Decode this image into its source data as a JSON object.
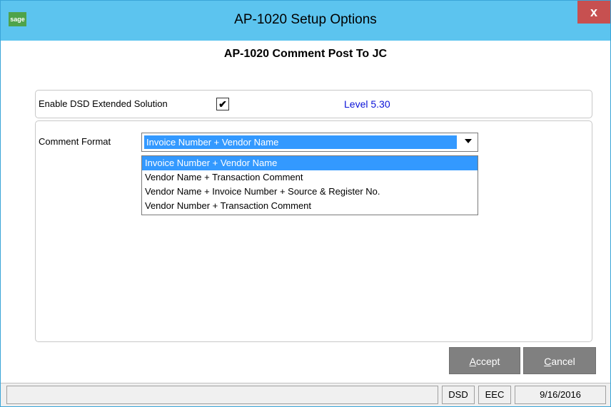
{
  "window": {
    "app_icon_text": "sage",
    "title": "AP-1020  Setup Options",
    "close_glyph": "x"
  },
  "panel": {
    "heading": "AP-1020 Comment Post To JC"
  },
  "enable": {
    "label": "Enable DSD Extended Solution",
    "checked": true,
    "check_glyph": "✔",
    "level": "Level  5.30"
  },
  "comment_format": {
    "label": "Comment Format",
    "selected": "Invoice Number + Vendor Name",
    "options": [
      "Invoice Number + Vendor Name",
      "Vendor Name + Transaction Comment",
      "Vendor Name + Invoice Number + Source & Register No.",
      "Vendor Number + Transaction Comment"
    ]
  },
  "buttons": {
    "accept_first": "A",
    "accept_rest": "ccept",
    "cancel_first": "C",
    "cancel_rest": "ancel"
  },
  "status": {
    "main": "",
    "dsd": "DSD",
    "eec": "EEC",
    "date": "9/16/2016"
  },
  "colors": {
    "titlebar": "#5cc4ef",
    "close_button": "#c75050",
    "selection": "#3399ff",
    "level_text": "#0a12d8",
    "button_bg": "#808080"
  }
}
